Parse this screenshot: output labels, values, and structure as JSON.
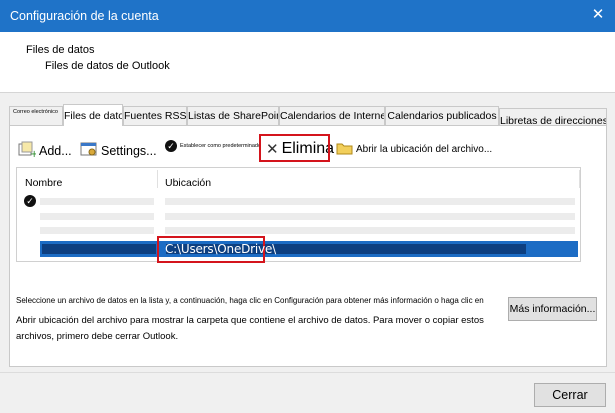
{
  "window": {
    "title": "Configuración de la cuenta",
    "close_glyph": "✕"
  },
  "header": {
    "title": "Files de datos",
    "subtitle": "Files de datos de Outlook"
  },
  "tabs": [
    {
      "label": "Correo electrónico"
    },
    {
      "label": "Files de datos"
    },
    {
      "label": "Fuentes RSS"
    },
    {
      "label": "Listas de SharePoint"
    },
    {
      "label": "Calendarios de Internet"
    },
    {
      "label": "Calendarios publicados"
    },
    {
      "label": "Libretas de direcciones"
    }
  ],
  "toolbar": {
    "add": "Add...",
    "settings": "Settings...",
    "set_default": "Establecer como predeterminado",
    "remove": "Elimina",
    "open_location": "Abrir la ubicación del archivo..."
  },
  "list": {
    "col_name": "Nombre",
    "col_location": "Ubicación",
    "selected_path": "C:\\Users\\OneDrive\\"
  },
  "description": {
    "line1": "Seleccione un archivo de datos en la lista y, a continuación, haga clic en Configuración para obtener más información o haga clic en",
    "line2": "Abrir ubicación del archivo para mostrar la carpeta que contiene el archivo de datos. Para mover o copiar estos archivos, primero debe cerrar Outlook."
  },
  "buttons": {
    "more_info": "Más información...",
    "close": "Cerrar"
  },
  "icons": {
    "add": "add-icon",
    "settings": "settings-icon",
    "default": "check-circle-icon",
    "remove": "close-x-icon",
    "folder": "folder-icon"
  },
  "colors": {
    "titlebar": "#1f73c8",
    "highlight": "#d4141c",
    "selection": "#1c6cc4"
  }
}
